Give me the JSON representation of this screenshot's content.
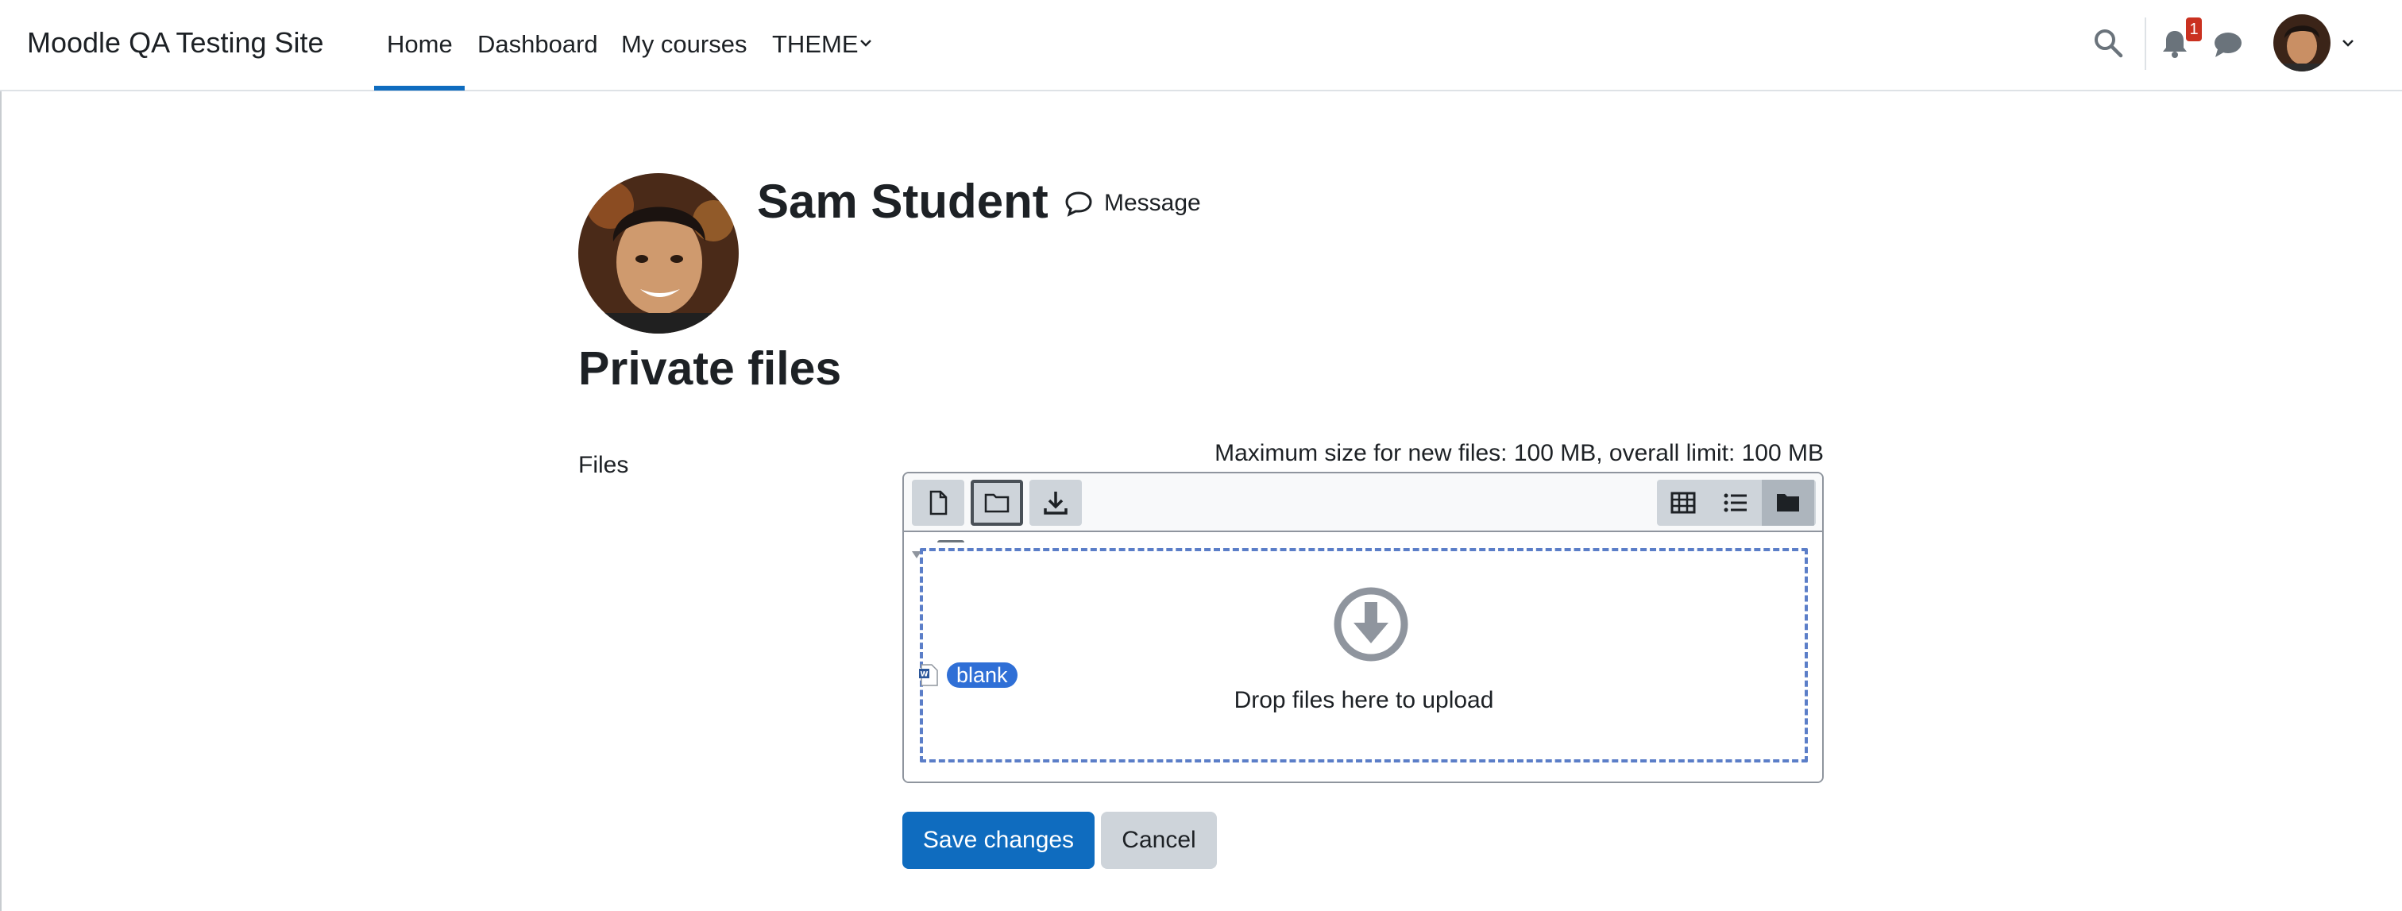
{
  "navbar": {
    "site_name": "Moodle QA Testing Site",
    "items": [
      {
        "label": "Home",
        "active": true
      },
      {
        "label": "Dashboard"
      },
      {
        "label": "My courses"
      },
      {
        "label": "THEME"
      }
    ],
    "notification_count": "1",
    "icons": [
      "search-icon",
      "bell-icon",
      "chat-icon",
      "chevron-down-icon"
    ],
    "accent_color": "#0f6cbf"
  },
  "profile": {
    "name": "Sam Student",
    "message_label": "Message"
  },
  "page": {
    "title": "Private files"
  },
  "form": {
    "files_label": "Files",
    "max_size_text": "Maximum size for new files: 100 MB, overall limit: 100 MB",
    "filepicker": {
      "toolbar_buttons": [
        "file-icon",
        "folder-icon",
        "download-icon"
      ],
      "view_modes": [
        "grid-view-icon",
        "list-view-icon",
        "tree-view-icon"
      ],
      "active_view": "tree-view-icon",
      "drop_text": "Drop files here to upload",
      "file": {
        "name": "blank",
        "type": "word-document"
      }
    },
    "save_label": "Save changes",
    "cancel_label": "Cancel"
  },
  "colors": {
    "primary": "#0f6cbf",
    "badge": "#ca3120",
    "secondary_button": "#ced4da",
    "dropzone_border": "#5b7ec8",
    "file_label_bg": "#2f6fd6"
  }
}
